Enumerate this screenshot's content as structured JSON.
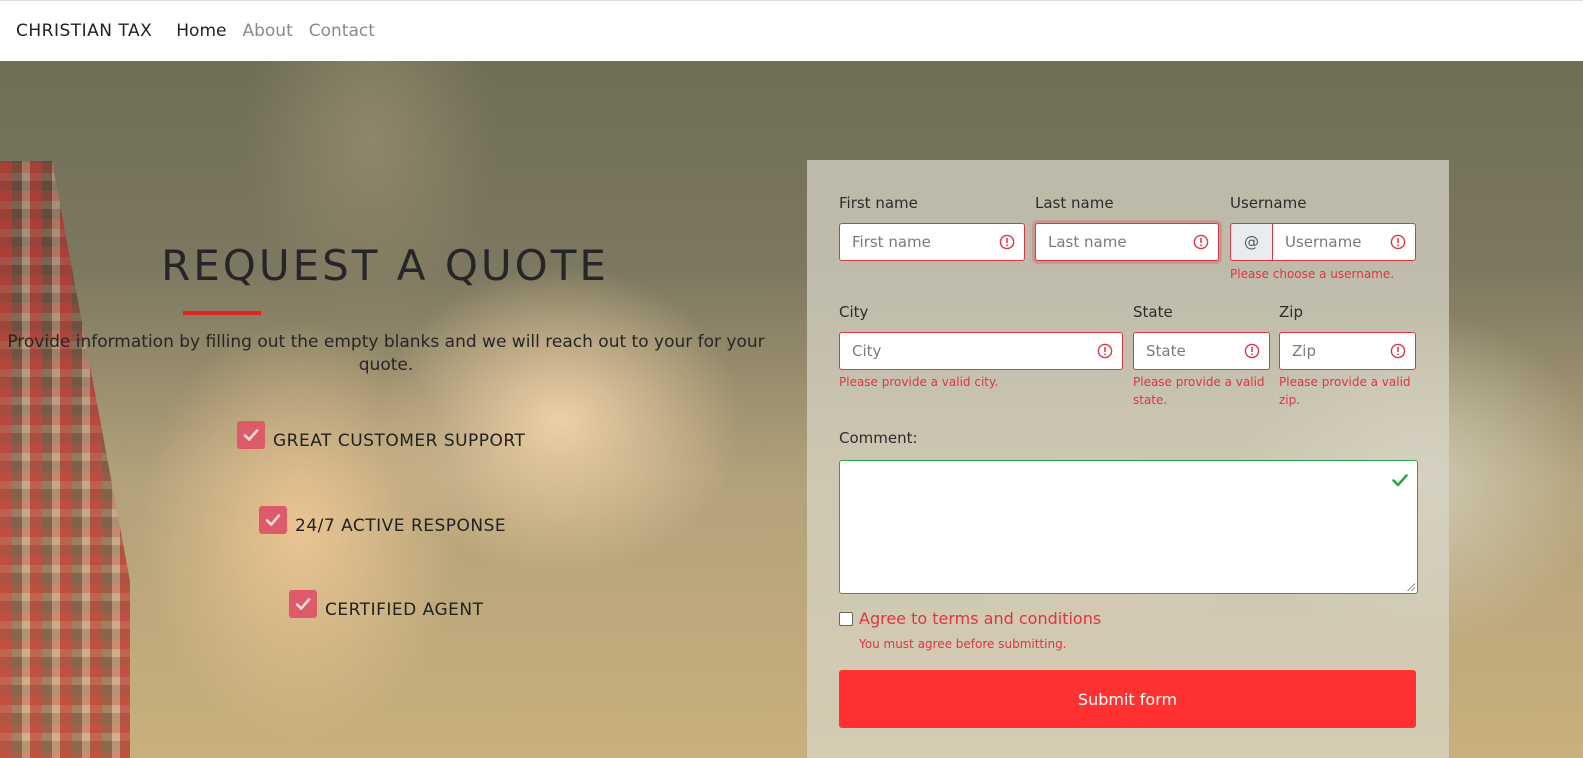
{
  "navbar": {
    "brand": "CHRISTIAN TAX",
    "links": [
      {
        "label": "Home",
        "active": true
      },
      {
        "label": "About",
        "active": false
      },
      {
        "label": "Contact",
        "active": false
      }
    ]
  },
  "hero": {
    "title": "REQUEST A QUOTE",
    "description": "Provide information by filling out the empty blanks and we will reach out to your for your quote.",
    "features": [
      {
        "label": "GREAT CUSTOMER SUPPORT",
        "icon": "check-icon"
      },
      {
        "label": "24/7 ACTIVE RESPONSE",
        "icon": "check-icon"
      },
      {
        "label": "CERTIFIED AGENT",
        "icon": "check-icon"
      }
    ],
    "accent_color": "#e32222"
  },
  "form": {
    "first_name": {
      "label": "First name",
      "placeholder": "First name",
      "value": ""
    },
    "last_name": {
      "label": "Last name",
      "placeholder": "Last name",
      "value": ""
    },
    "username": {
      "label": "Username",
      "placeholder": "Username",
      "prefix": "@",
      "value": "",
      "error": "Please choose a username."
    },
    "city": {
      "label": "City",
      "placeholder": "City",
      "value": "",
      "error": "Please provide a valid city."
    },
    "state": {
      "label": "State",
      "placeholder": "State",
      "value": "",
      "error_line1": "Please provide a valid",
      "error_line2": "state."
    },
    "zip": {
      "label": "Zip",
      "placeholder": "Zip",
      "value": "",
      "error_line1": "Please provide a valid",
      "error_line2": "zip."
    },
    "comment": {
      "label": "Comment:",
      "value": ""
    },
    "terms": {
      "label": "Agree to terms and conditions",
      "checked": false,
      "error": "You must agree before submitting."
    },
    "submit_label": "Submit form",
    "colors": {
      "invalid": "#dc3545",
      "valid": "#28a745",
      "submit": "#ff3131"
    }
  }
}
